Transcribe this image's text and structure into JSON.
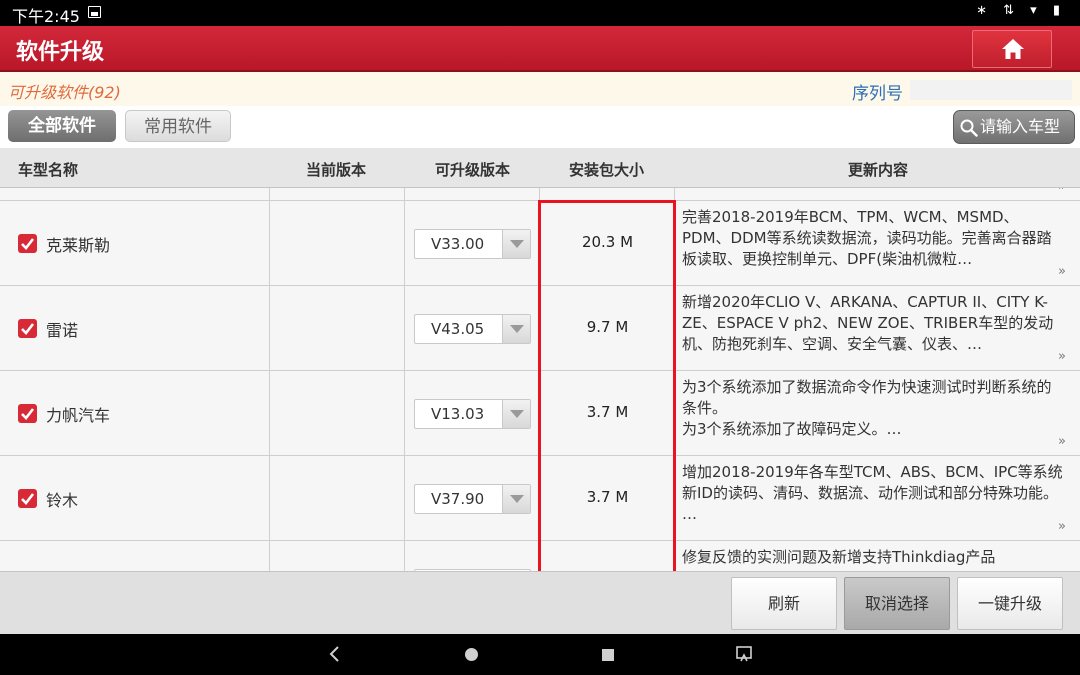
{
  "status_bar": {
    "time": "下午2:45",
    "right_icons": "∗ ⇅ ▾ ▮"
  },
  "header": {
    "title": "软件升级"
  },
  "info": {
    "upgradable_label": "可升级软件(92)",
    "serial_label": "序列号"
  },
  "tabs": {
    "all": "全部软件",
    "common": "常用软件"
  },
  "search": {
    "label": "请输入车型"
  },
  "columns": {
    "model": "车型名称",
    "current_version": "当前版本",
    "upgradable_version": "可升级版本",
    "size": "安装包大小",
    "content": "更新内容"
  },
  "rows": [
    {
      "brand": "克莱斯勒",
      "version": "V33.00",
      "size": "20.3 M",
      "desc": "完善2018-2019年BCM、TPM、WCM、MSMD、PDM、DDM等系统读数据流，读码功能。完善离合器踏板读取、更换控制单元、DPF(柴油机微粒…"
    },
    {
      "brand": "雷诺",
      "version": "V43.05",
      "size": "9.7 M",
      "desc": "新增2020年CLIO V、ARKANA、CAPTUR II、CITY K-ZE、ESPACE V ph2、NEW ZOE、TRIBER车型的发动机、防抱死刹车、空调、安全气囊、仪表、…"
    },
    {
      "brand": "力帆汽车",
      "version": "V13.03",
      "size": "3.7 M",
      "desc": "为3个系统添加了数据流命令作为快速测试时判断系统的条件。\n为3个系统添加了故障码定义。…"
    },
    {
      "brand": "铃木",
      "version": "V37.90",
      "size": "3.7 M",
      "desc": "增加2018-2019年各车型TCM、ABS、BCM、IPC等系统新ID的读码、清码、数据流、动作测试和部分特殊功能。 …"
    }
  ],
  "partial_row": {
    "desc": "修复反馈的实测问题及新增支持Thinkdiag产品"
  },
  "more_glyph": "»",
  "actions": {
    "refresh": "刷新",
    "cancel_select": "取消选择",
    "one_key_upgrade": "一键升级"
  },
  "colors": {
    "title_red": "#c8202f",
    "highlight_red": "#e8141f",
    "checkbox_red": "#d82a36"
  }
}
